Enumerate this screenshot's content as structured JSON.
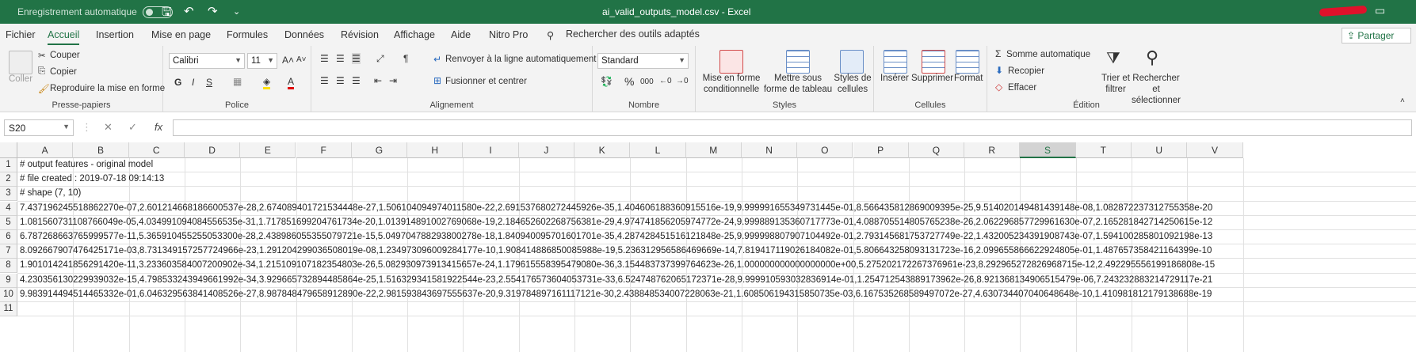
{
  "titlebar": {
    "autosave_label": "Enregistrement automatique",
    "doc_title": "ai_valid_outputs_model.csv  -  Excel",
    "accent_color": "#217346"
  },
  "tabs": [
    "Fichier",
    "Accueil",
    "Insertion",
    "Mise en page",
    "Formules",
    "Données",
    "Révision",
    "Affichage",
    "Aide",
    "Nitro Pro"
  ],
  "active_tab": "Accueil",
  "search": {
    "label": "Rechercher des outils adaptés"
  },
  "share_label": "Partager",
  "ribbon": {
    "clipboard": {
      "paste": "Coller",
      "cut": "Couper",
      "copy": "Copier",
      "format_painter": "Reproduire la mise en forme",
      "label": "Presse-papiers"
    },
    "font": {
      "font_name": "Calibri",
      "font_size": "11",
      "bold": "G",
      "italic": "I",
      "underline": "S",
      "label": "Police"
    },
    "alignment": {
      "wrap": "Renvoyer à la ligne automatiquement",
      "merge": "Fusionner et centrer",
      "label": "Alignement"
    },
    "number": {
      "format": "Standard",
      "percent": "%",
      "thousands": "000",
      "label": "Nombre"
    },
    "styles": {
      "conditional": "Mise en forme conditionnelle",
      "table": "Mettre sous forme de tableau",
      "cell_styles": "Styles de cellules",
      "label": "Styles"
    },
    "cells": {
      "insert": "Insérer",
      "delete": "Supprimer",
      "format": "Format",
      "label": "Cellules"
    },
    "editing": {
      "autosum": "Somme automatique",
      "fill": "Recopier",
      "clear": "Effacer",
      "sort": "Trier et filtrer",
      "find": "Rechercher et sélectionner",
      "label": "Édition"
    }
  },
  "formula_bar": {
    "name_box": "S20",
    "fx": "fx",
    "value": ""
  },
  "columns": [
    "A",
    "B",
    "C",
    "D",
    "E",
    "F",
    "G",
    "H",
    "I",
    "J",
    "K",
    "L",
    "M",
    "N",
    "O",
    "P",
    "Q",
    "R",
    "S",
    "T",
    "U",
    "V"
  ],
  "selected_column": "S",
  "rows": [
    {
      "num": "1",
      "text": "# output features - original model"
    },
    {
      "num": "2",
      "text": "# file created : 2019-07-18 09:14:13"
    },
    {
      "num": "3",
      "text": "# shape (7, 10)"
    },
    {
      "num": "4",
      "text": "7.437196245518862270e-07,2.601214668186600537e-28,2.674089401721534448e-27,1.506104094974011580e-22,2.691537680272445926e-35,1.404606188360915516e-19,9.999991655349731445e-01,8.566435812869009395e-25,9.514020149481439148e-08,1.082872237312755358e-20"
    },
    {
      "num": "5",
      "text": "1.081560731108766049e-05,4.034991094084556535e-31,1.717851699204761734e-20,1.013914891002769068e-19,2.184652602268756381e-29,4.974741856205974772e-24,9.999889135360717773e-01,4.088705514805765238e-26,2.062296857729961630e-07,2.165281842714250615e-12"
    },
    {
      "num": "6",
      "text": "6.787268663765999577e-11,5.365910455255053300e-28,2.438986055355079721e-15,5.049704788293800278e-18,1.840940095701601701e-35,4.287428451516121848e-25,9.999998807907104492e-01,2.793145681753727749e-22,1.432005234391908743e-07,1.594100285801092198e-13"
    },
    {
      "num": "7",
      "text": "8.092667907476425171e-03,8.731349157257724966e-23,1.291204299036508019e-08,1.234973096009284177e-10,1.908414886850085988e-19,5.236312956586469669e-14,7.819417119026184082e-01,5.806643258093131723e-16,2.099655866622924805e-01,1.487657358421164399e-10"
    },
    {
      "num": "8",
      "text": "1.901014241856291420e-11,3.233603584007200902e-34,1.215109107182354803e-26,5.082930973913415657e-24,1.179615558395479080e-36,3.154483737399764623e-26,1.000000000000000000e+00,5.275202172267376961e-23,8.292965272826968715e-12,2.492295556199186808e-15"
    },
    {
      "num": "9",
      "text": "4.230356130229939032e-15,4.798533243949661992e-34,3.929665732894485864e-25,1.516329341581922544e-23,2.554176573604053731e-33,6.524748762065172371e-28,9.999910593032836914e-01,1.254712543889173962e-26,8.921368134906515479e-06,7.243232883214729117e-21"
    },
    {
      "num": "10",
      "text": "9.983914494514465332e-01,6.046329563841408526e-27,8.987848479658912890e-22,2.981593843697555637e-20,9.319784897161117121e-30,2.438848534007228063e-21,1.608506194315850735e-03,6.167535268589497072e-27,4.630734407040648648e-10,1.410981812179138688e-19"
    },
    {
      "num": "11",
      "text": ""
    }
  ]
}
